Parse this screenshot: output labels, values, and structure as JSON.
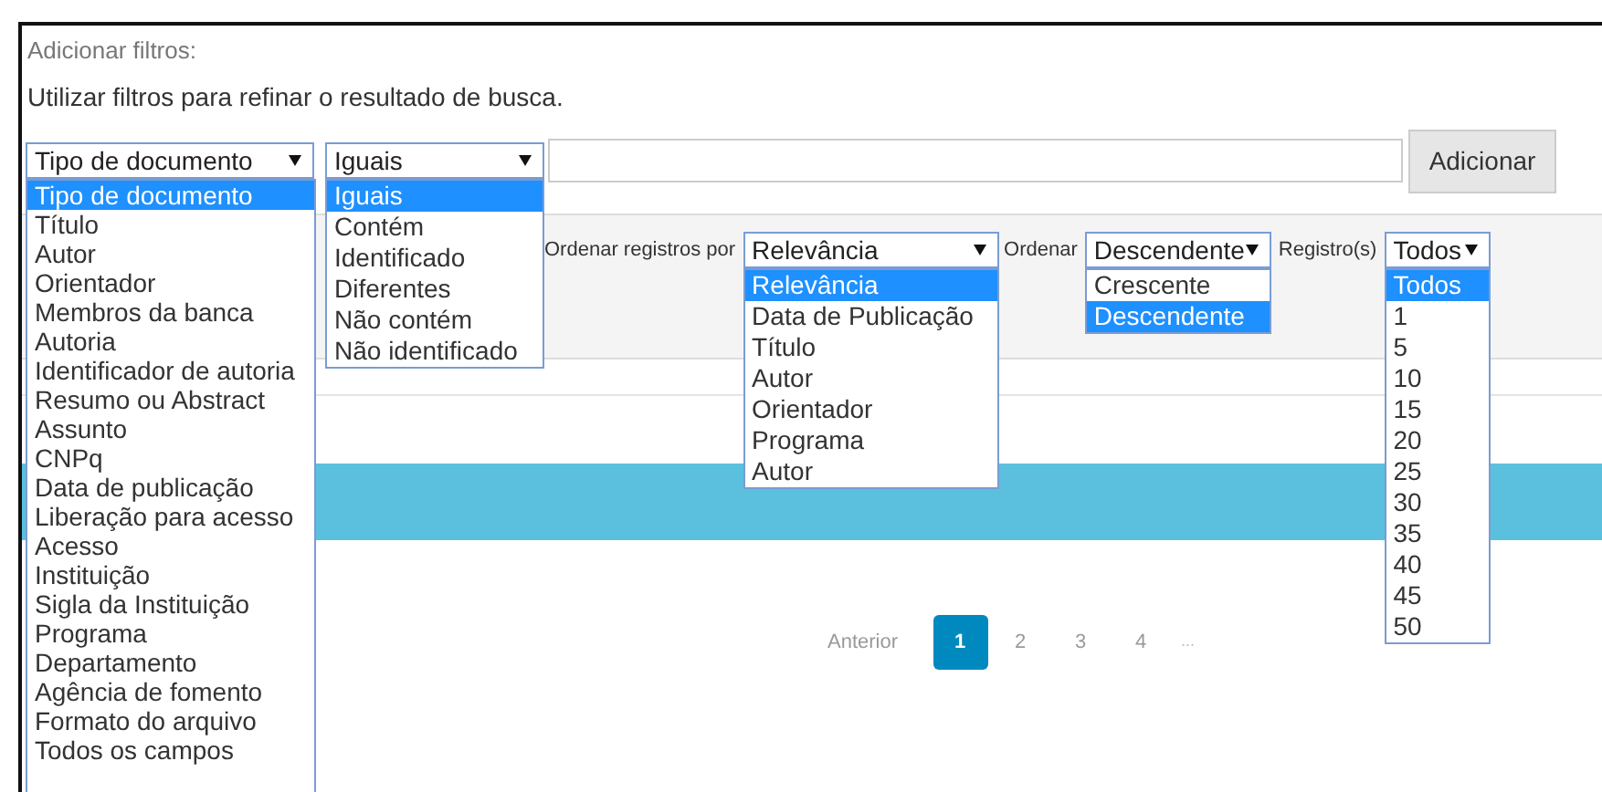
{
  "header": {
    "title": "Adicionar filtros:",
    "description": "Utilizar filtros para refinar o resultado de busca."
  },
  "filter": {
    "field_select": {
      "value": "Tipo de documento",
      "options": [
        {
          "label": "Tipo de documento",
          "selected": true
        },
        {
          "label": "Título",
          "selected": false
        },
        {
          "label": "Autor",
          "selected": false
        },
        {
          "label": "Orientador",
          "selected": false
        },
        {
          "label": "Membros da banca",
          "selected": false
        },
        {
          "label": "Autoria",
          "selected": false
        },
        {
          "label": "Identificador de autoria",
          "selected": false
        },
        {
          "label": "Resumo ou Abstract",
          "selected": false
        },
        {
          "label": "Assunto",
          "selected": false
        },
        {
          "label": "CNPq",
          "selected": false
        },
        {
          "label": "Data de publicação",
          "selected": false
        },
        {
          "label": "Liberação para acesso",
          "selected": false
        },
        {
          "label": "Acesso",
          "selected": false
        },
        {
          "label": "Instituição",
          "selected": false
        },
        {
          "label": "Sigla da Instituição",
          "selected": false
        },
        {
          "label": "Programa",
          "selected": false
        },
        {
          "label": "Departamento",
          "selected": false
        },
        {
          "label": "Agência de fomento",
          "selected": false
        },
        {
          "label": "Formato do arquivo",
          "selected": false
        },
        {
          "label": "Todos os campos",
          "selected": false
        }
      ]
    },
    "operator_select": {
      "value": "Iguais",
      "options": [
        {
          "label": "Iguais",
          "selected": true
        },
        {
          "label": "Contém",
          "selected": false
        },
        {
          "label": "Identificado",
          "selected": false
        },
        {
          "label": "Diferentes",
          "selected": false
        },
        {
          "label": "Não contém",
          "selected": false
        },
        {
          "label": "Não identificado",
          "selected": false
        }
      ]
    },
    "add_button": "Adicionar"
  },
  "sort": {
    "sort_by_label": "Ordenar registros por",
    "sort_by": {
      "value": "Relevância",
      "options": [
        {
          "label": "Relevância",
          "selected": true
        },
        {
          "label": "Data de Publicação",
          "selected": false
        },
        {
          "label": "Título",
          "selected": false
        },
        {
          "label": "Autor",
          "selected": false
        },
        {
          "label": "Orientador",
          "selected": false
        },
        {
          "label": "Programa",
          "selected": false
        },
        {
          "label": "Autor",
          "selected": false
        }
      ]
    },
    "order_label": "Ordenar",
    "order": {
      "value": "Descendente",
      "options": [
        {
          "label": "Crescente",
          "selected": false
        },
        {
          "label": "Descendente",
          "selected": true
        }
      ]
    },
    "records_label": "Registro(s)",
    "records": {
      "value": "Todos",
      "options": [
        {
          "label": "Todos",
          "selected": true
        },
        {
          "label": "1",
          "selected": false
        },
        {
          "label": "5",
          "selected": false
        },
        {
          "label": "10",
          "selected": false
        },
        {
          "label": "15",
          "selected": false
        },
        {
          "label": "20",
          "selected": false
        },
        {
          "label": "25",
          "selected": false
        },
        {
          "label": "30",
          "selected": false
        },
        {
          "label": "35",
          "selected": false
        },
        {
          "label": "40",
          "selected": false
        },
        {
          "label": "45",
          "selected": false
        },
        {
          "label": "50",
          "selected": false
        }
      ]
    }
  },
  "pagination": {
    "previous": "Anterior",
    "pages": [
      {
        "label": "1",
        "selected": true
      },
      {
        "label": "2",
        "selected": false
      },
      {
        "label": "3",
        "selected": false
      },
      {
        "label": "4",
        "selected": false
      }
    ],
    "ellipsis": "..."
  }
}
